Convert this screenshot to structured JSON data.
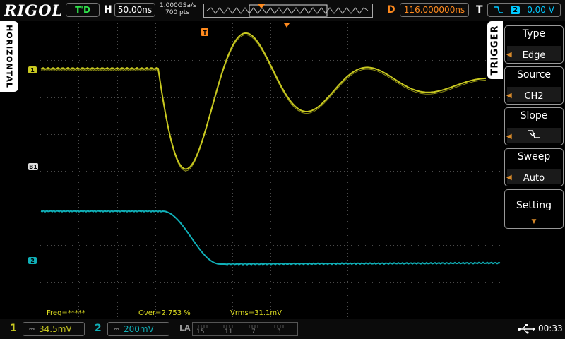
{
  "header": {
    "brand": "RIGOL",
    "run_state": "T'D",
    "h_label": "H",
    "timebase": "50.00ns",
    "sample_rate": "1.000GSa/s",
    "memory_depth": "700 pts",
    "d_label": "D",
    "delay": "116.000000ns",
    "t_label": "T",
    "trigger_source": "2",
    "trigger_level": "0.00 V"
  },
  "left_tab": {
    "label": "HORIZONTAL"
  },
  "screen": {
    "ch1_marker": "1",
    "ref_marker": "B1",
    "ch2_marker": "2",
    "trigger_marker": "T",
    "ch1_color": "#c8c820",
    "ch2_color": "#10b0b8"
  },
  "measurements": {
    "freq": "Freq=*****",
    "over": "Over=2.753 %",
    "vrms": "Vrms=31.1mV"
  },
  "menu": {
    "title": "TRIGGER",
    "items": [
      {
        "title": "Type",
        "value": "Edge"
      },
      {
        "title": "Source",
        "value": "CH2"
      },
      {
        "title": "Slope",
        "value": "falling-edge-icon"
      },
      {
        "title": "Sweep",
        "value": "Auto"
      },
      {
        "title": "Setting",
        "value": ""
      }
    ]
  },
  "footer": {
    "ch1_num": "1",
    "ch1_scale": "34.5mV",
    "ch2_num": "2",
    "ch2_scale": "200mV",
    "la_label": "LA",
    "la_digits": [
      "15",
      "11",
      "7",
      "3"
    ],
    "time": "00:33"
  }
}
